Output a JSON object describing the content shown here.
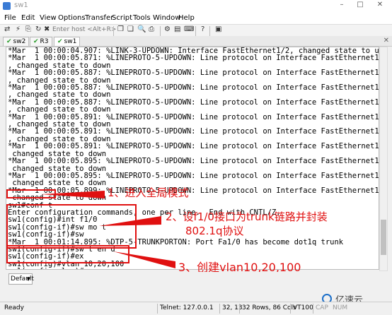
{
  "window": {
    "title": "sw1"
  },
  "menu": [
    "File",
    "Edit",
    "View",
    "Options",
    "Transfer",
    "Script",
    "Tools",
    "Window",
    "Help"
  ],
  "toolbar": {
    "host_placeholder": "Enter host <Alt+R>"
  },
  "tabs": [
    {
      "label": "sw2",
      "connected": true
    },
    {
      "label": "R3",
      "connected": true
    },
    {
      "label": "sw1",
      "connected": true,
      "active": true
    }
  ],
  "terminal": {
    "lines": [
      "*Mar  1 00:00:04.907: %LINK-3-UPDOWN: Interface FastEthernet1/2, changed state to up",
      "*Mar  1 00:00:05.871: %LINEPROTO-5-UPDOWN: Line protocol on Interface FastEthernet1/15",
      ", changed state to down",
      "*Mar  1 00:00:05.887: %LINEPROTO-5-UPDOWN: Line protocol on Interface FastEthernet1/14",
      ", changed state to down",
      "*Mar  1 00:00:05.887: %LINEPROTO-5-UPDOWN: Line protocol on Interface FastEthernet1/13",
      ", changed state to down",
      "*Mar  1 00:00:05.887: %LINEPROTO-5-UPDOWN: Line protocol on Interface FastEthernet1/12",
      ", changed state to down",
      "*Mar  1 00:00:05.891: %LINEPROTO-5-UPDOWN: Line protocol on Interface FastEthernet1/11",
      ", changed state to down",
      "*Mar  1 00:00:05.891: %LINEPROTO-5-UPDOWN: Line protocol on Interface FastEthernet1/10",
      ", changed state to down",
      "*Mar  1 00:00:05.891: %LINEPROTO-5-UPDOWN: Line protocol on Interface FastEthernet1/9,",
      " changed state to down",
      "*Mar  1 00:00:05.895: %LINEPROTO-5-UPDOWN: Line protocol on Interface FastEthernet1/8,",
      " changed state to down",
      "*Mar  1 00:00:05.895: %LINEPROTO-5-UPDOWN: Line protocol on Interface FastEthernet1/7,",
      " changed state to down",
      "*Mar  1 00:00:05.899: %LINEPROTO-5-UPDOWN: Line protocol on Interface FastEthernet1/6,",
      " changed state to down",
      "sw1#conf t",
      "Enter configuration commands, one per line.  End with CNTL/Z.",
      "sw1(config)#int f1/0",
      "sw1(config-if)#sw mo t",
      "sw1(config-if)#sw",
      "*Mar  1 00:01:14.895: %DTP-5-TRUNKPORTON: Port Fa1/0 has become dot1q trunk",
      "sw1(config-if)#sw t en d",
      "sw1(config-if)#ex",
      "sw1(config)#vlan 10,20,100",
      "sw1(config-vlan)#ex",
      "sw1(config)#"
    ]
  },
  "annotations": {
    "a1": "1、进入全局模式",
    "a2_line1": "2、设f1/0接口为trunk链路并封装",
    "a2_line2": "802.1q协议",
    "a3": "3、创建vlan10,20,100"
  },
  "input_bar": {
    "session_select": "Default"
  },
  "statusbar": {
    "state": "Ready",
    "connection": "Telnet: 127.0.0.1",
    "cursor": "32, 13",
    "size": "32 Rows, 86 Cols",
    "emulation": "VT100",
    "caps": "CAP",
    "num": "NUM"
  },
  "watermark": "亿速云",
  "colors": {
    "annotation": "#e01010",
    "tab_check": "#2a9d2a"
  }
}
